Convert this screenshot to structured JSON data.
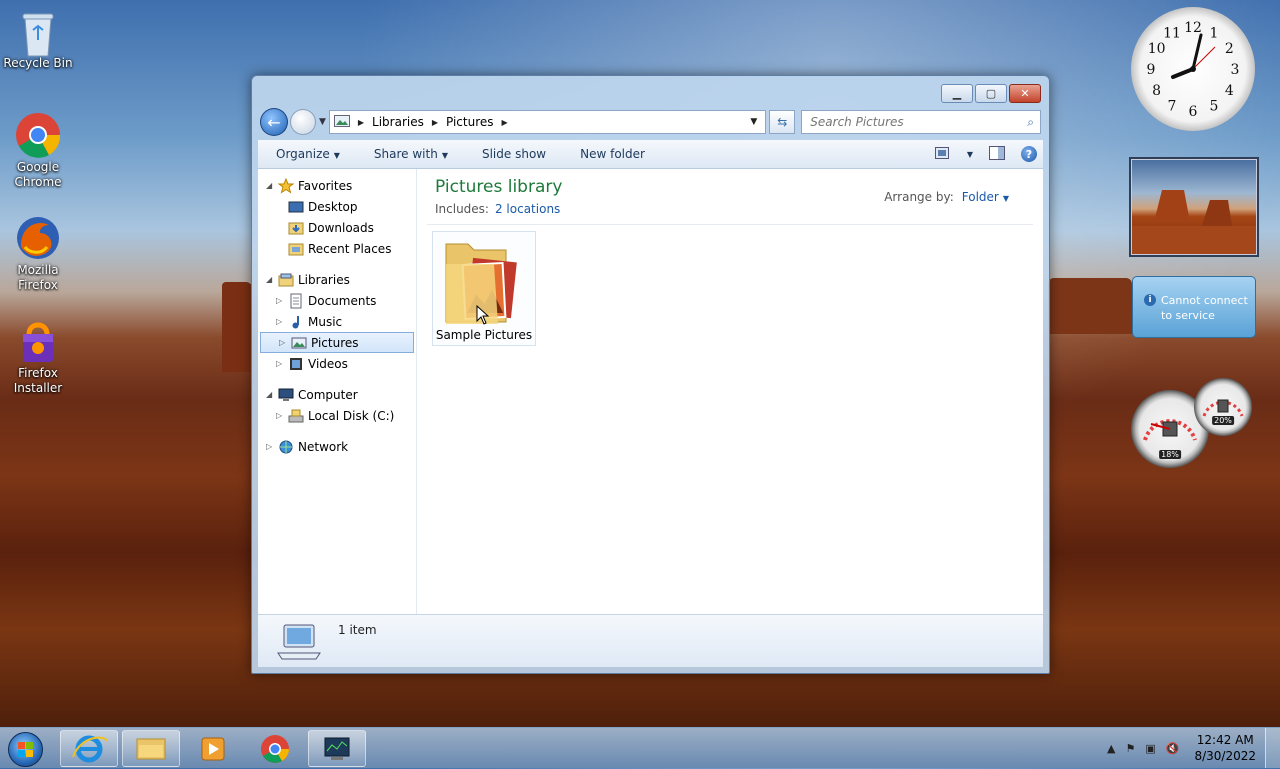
{
  "desktop": {
    "icons": [
      {
        "label": "Recycle Bin"
      },
      {
        "label": "Google Chrome"
      },
      {
        "label": "Mozilla Firefox"
      },
      {
        "label": "Firefox Installer"
      }
    ]
  },
  "explorer": {
    "address": {
      "segments": [
        "Libraries",
        "Pictures"
      ]
    },
    "search": {
      "placeholder": "Search Pictures"
    },
    "toolbar": {
      "organize": "Organize",
      "share_with": "Share with",
      "slide_show": "Slide show",
      "new_folder": "New folder"
    },
    "tree": {
      "favorites": "Favorites",
      "desktop": "Desktop",
      "downloads": "Downloads",
      "recent_places": "Recent Places",
      "libraries": "Libraries",
      "documents": "Documents",
      "music": "Music",
      "pictures": "Pictures",
      "videos": "Videos",
      "computer": "Computer",
      "local_disk": "Local Disk (C:)",
      "network": "Network"
    },
    "library": {
      "title": "Pictures library",
      "includes_label": "Includes:",
      "includes_link": "2 locations",
      "arrange_label": "Arrange by:",
      "arrange_value": "Folder"
    },
    "items": [
      {
        "label": "Sample Pictures"
      }
    ],
    "status": {
      "count": "1 item"
    }
  },
  "gadgets": {
    "weather_message": "Cannot connect to service",
    "cpu_percent": "18%",
    "memory_percent": "20%",
    "clock_numerals": [
      "12",
      "1",
      "2",
      "3",
      "4",
      "5",
      "6",
      "7",
      "8",
      "9",
      "10",
      "11"
    ]
  },
  "taskbar": {
    "time": "12:42 AM",
    "date": "8/30/2022"
  },
  "colors": {
    "library_title": "#1e7a3a",
    "link": "#1a5aa8",
    "accent": "#2a6ab8"
  }
}
